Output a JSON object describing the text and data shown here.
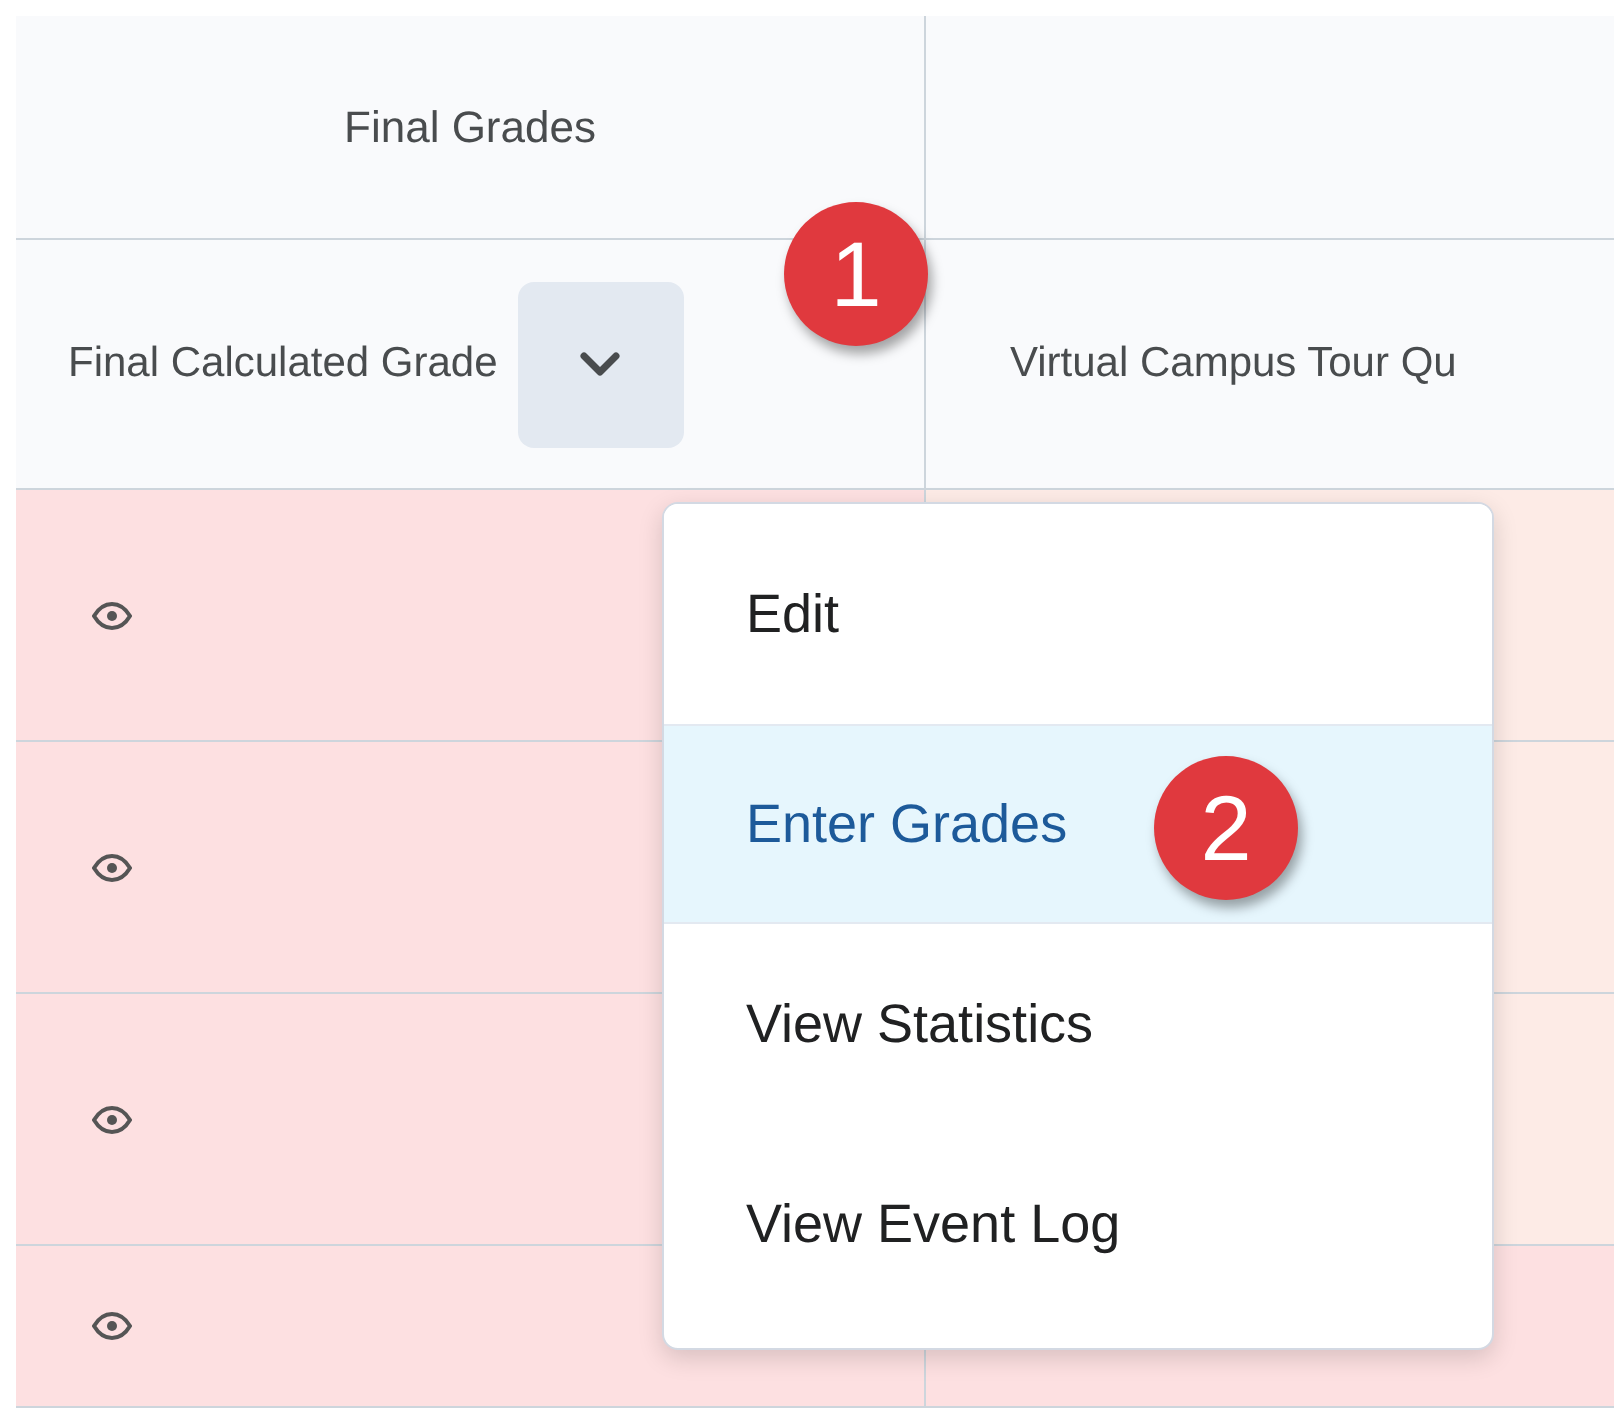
{
  "table": {
    "group_header": "Final Grades",
    "columns": [
      {
        "label": "Final Calculated Grade",
        "has_menu": true
      },
      {
        "label": "Virtual Campus Tour Qu",
        "has_menu": false
      }
    ],
    "rows": [
      {
        "color": "#fdebe6"
      },
      {
        "color": "#fdebe6"
      },
      {
        "color": "#fdebe6"
      },
      {
        "color": "#fde0e1"
      }
    ]
  },
  "menu": {
    "items": [
      {
        "label": "Edit",
        "selected": false
      },
      {
        "label": "Enter Grades",
        "selected": true
      },
      {
        "label": "View Statistics",
        "selected": false
      },
      {
        "label": "View Event Log",
        "selected": false
      }
    ]
  },
  "annotations": [
    {
      "label": "1"
    },
    {
      "label": "2"
    }
  ]
}
